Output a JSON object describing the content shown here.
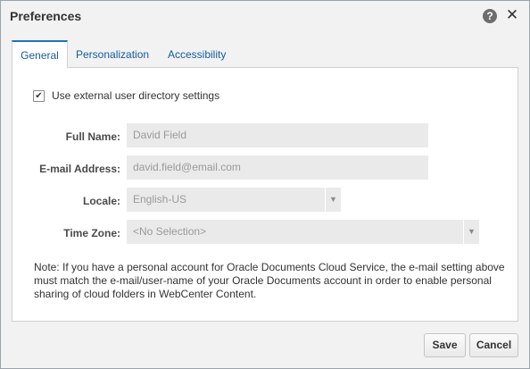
{
  "dialog": {
    "title": "Preferences",
    "help_icon": "help-icon",
    "close_icon": "close-icon"
  },
  "tabs": [
    {
      "label": "General",
      "active": true
    },
    {
      "label": "Personalization",
      "active": false
    },
    {
      "label": "Accessibility",
      "active": false
    }
  ],
  "general": {
    "use_external_checkbox": {
      "label": "Use external user directory settings",
      "checked": true
    },
    "fields": {
      "full_name": {
        "label": "Full Name:",
        "value": "David Field"
      },
      "email": {
        "label": "E-mail Address:",
        "value": "david.field@email.com"
      },
      "locale": {
        "label": "Locale:",
        "value": "English-US"
      },
      "timezone": {
        "label": "Time Zone:",
        "value": "<No Selection>"
      }
    },
    "note": "Note: If you have a personal account for Oracle Documents Cloud Service, the e-mail setting above must match the e-mail/user-name of your Oracle Documents account in order to enable personal sharing of cloud folders in WebCenter Content."
  },
  "buttons": {
    "save": "Save",
    "cancel": "Cancel"
  },
  "colors": {
    "accent": "#1e73c0",
    "tab_text": "#145c9e",
    "input_bg": "#eaeaea"
  }
}
